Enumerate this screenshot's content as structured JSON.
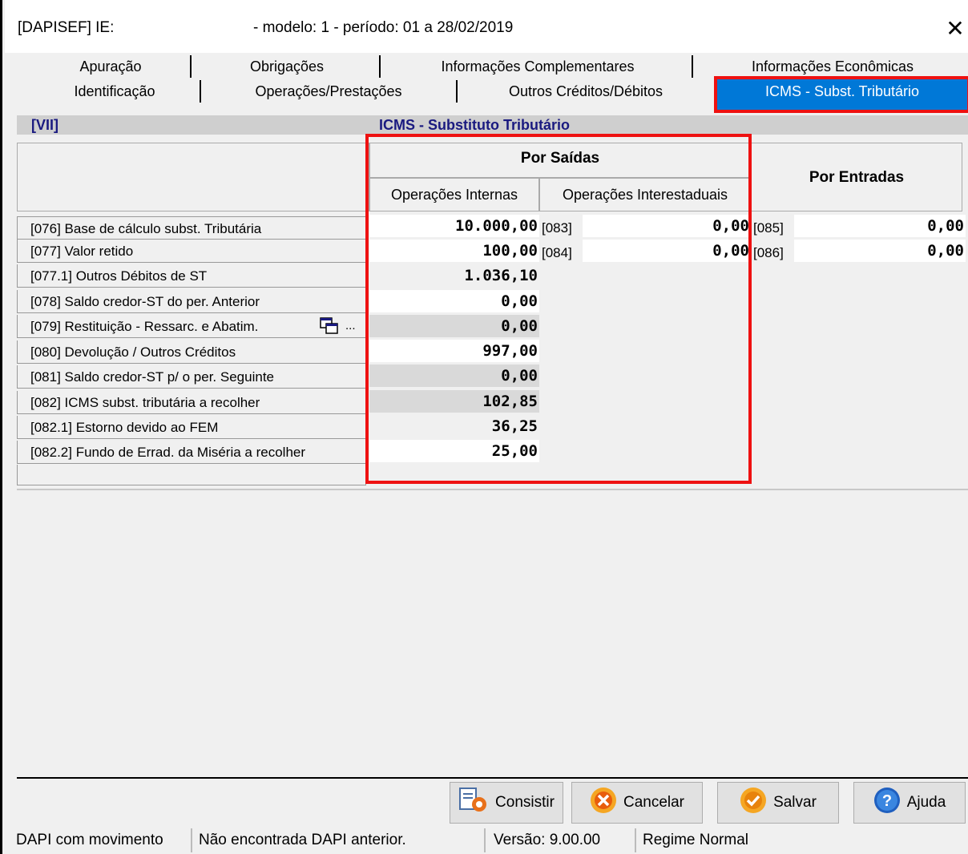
{
  "window": {
    "title_left": "[DAPISEF] IE:",
    "title_right": "- modelo: 1 -  período: 01 a 28/02/2019",
    "close_glyph": "✕"
  },
  "tabs": {
    "row1": [
      "Apuração",
      "Obrigações",
      "Informações Complementares",
      "Informações Econômicas"
    ],
    "row2": [
      "Identificação",
      "Operações/Prestações",
      "Outros Créditos/Débitos",
      "ICMS - Subst. Tributário"
    ],
    "active": "ICMS - Subst. Tributário"
  },
  "section": {
    "number": "[VII]",
    "title": "ICMS - Substituto Tributário"
  },
  "headers": {
    "por_saidas": "Por Saídas",
    "operacoes_internas": "Operações Internas",
    "operacoes_interestaduais": "Operações Interestaduais",
    "por_entradas": "Por Entradas"
  },
  "rows": [
    {
      "label": "[076] Base de cálculo subst. Tributária",
      "value": "10.000,00",
      "shade": "white"
    },
    {
      "label": "[077] Valor retido",
      "value": "100,00",
      "shade": "white"
    },
    {
      "label": "[077.1] Outros Débitos de ST",
      "value": "1.036,10",
      "shade": "none"
    },
    {
      "label": "[078] Saldo credor-ST do per. Anterior",
      "value": "0,00",
      "shade": "white"
    },
    {
      "label": "[079] Restituição - Ressarc. e Abatim.",
      "value": "0,00",
      "shade": "grey"
    },
    {
      "label": "[080] Devolução / Outros Créditos",
      "value": "997,00",
      "shade": "white"
    },
    {
      "label": "[081] Saldo credor-ST p/ o per. Seguinte",
      "value": "0,00",
      "shade": "grey"
    },
    {
      "label": "[082] ICMS subst. tributária a recolher",
      "value": "102,85",
      "shade": "grey"
    },
    {
      "label": "[082.1] Estorno devido ao FEM",
      "value": "36,25",
      "shade": "none"
    },
    {
      "label": "[082.2] Fundo de Errad. da Miséria a recolher",
      "value": "25,00",
      "shade": "white"
    }
  ],
  "interestaduais": [
    {
      "code": "[083]",
      "value": "0,00"
    },
    {
      "code": "[084]",
      "value": "0,00"
    }
  ],
  "entradas": [
    {
      "code": "[085]",
      "value": "0,00"
    },
    {
      "code": "[086]",
      "value": "0,00"
    }
  ],
  "row079_icon_ellipsis": "...",
  "buttons": {
    "consistir": "Consistir",
    "cancelar": "Cancelar",
    "salvar": "Salvar",
    "ajuda": "Ajuda"
  },
  "status": {
    "movimento": "DAPI com movimento",
    "anterior": "Não encontrada DAPI anterior.",
    "versao": "Versão: 9.00.00",
    "regime": "Regime Normal"
  },
  "colors": {
    "active_tab": "#0078d7",
    "highlight_border": "#e11",
    "section_text": "#1a1a80"
  }
}
